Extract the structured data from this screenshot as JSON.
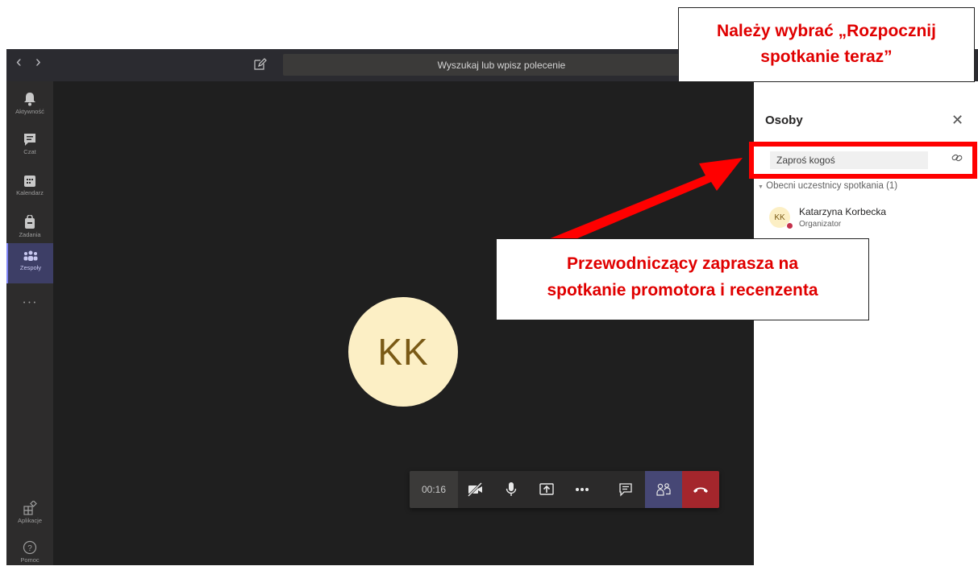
{
  "titlebar": {
    "search_placeholder": "Wyszukaj lub wpisz polecenie",
    "back_glyph": "‹",
    "forward_glyph": "›"
  },
  "rail": {
    "items": [
      {
        "label": "Aktywność",
        "icon": "bell-icon"
      },
      {
        "label": "Czat",
        "icon": "chat-icon"
      },
      {
        "label": "Kalendarz",
        "icon": "calendar-icon"
      },
      {
        "label": "Zadania",
        "icon": "bag-icon"
      },
      {
        "label": "Zespoły",
        "icon": "teams-icon"
      }
    ],
    "more_glyph": "• • •",
    "apps_label": "Aplikacje",
    "help_label": "Pomoc"
  },
  "stage": {
    "avatar_initials": "KK"
  },
  "controls": {
    "timer": "00:16"
  },
  "people_panel": {
    "title": "Osoby",
    "close_glyph": "✕",
    "invite_placeholder": "Zaproś kogoś",
    "section_header": "Obecni uczestnicy spotkania (1)",
    "participants": [
      {
        "initials": "KK",
        "name": "Katarzyna Korbecka",
        "role": "Organizator",
        "status_color": "#c4314b"
      }
    ]
  },
  "annotations": {
    "top_line1": "Należy wybrać „Rozpocznij",
    "top_line2": "spotkanie teraz”",
    "middle_line1": "Przewodniczący zaprasza na",
    "middle_line2": "spotkanie promotora i recenzenta",
    "color": "#e00000"
  }
}
